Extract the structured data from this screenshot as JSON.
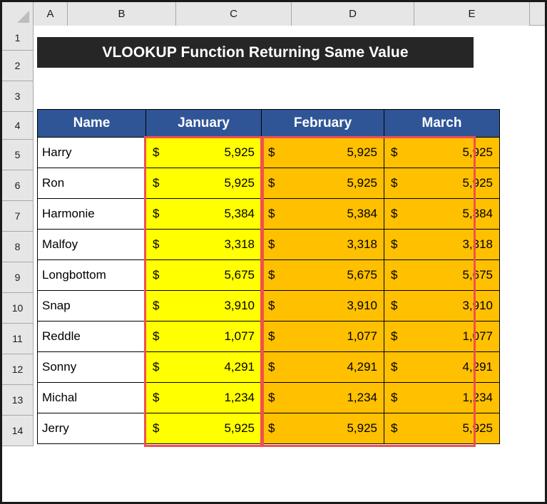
{
  "spreadsheet": {
    "column_headers": [
      "A",
      "B",
      "C",
      "D",
      "E"
    ],
    "row_headers": [
      "1",
      "2",
      "3",
      "4",
      "5",
      "6",
      "7",
      "8",
      "9",
      "10",
      "11",
      "12",
      "13",
      "14"
    ],
    "select_all_icon": "select-all-triangle-icon"
  },
  "title": {
    "text": "VLOOKUP Function Returning Same Value",
    "background": "#262626",
    "color": "#FFFFFF"
  },
  "table": {
    "headers": [
      "Name",
      "January",
      "February",
      "March"
    ],
    "header_background": "#2F5597",
    "header_color": "#FFFFFF",
    "currency_symbol": "$",
    "column_fills": {
      "name": "#FFFFFF",
      "january": "#FFFF00",
      "february": "#FFC000",
      "march": "#FFC000"
    },
    "range_outline_color": "#F24F4F",
    "rows": [
      {
        "name": "Harry",
        "january": "5,925",
        "february": "5,925",
        "march": "5,925"
      },
      {
        "name": "Ron",
        "january": "5,925",
        "february": "5,925",
        "march": "5,925"
      },
      {
        "name": "Harmonie",
        "january": "5,384",
        "february": "5,384",
        "march": "5,384"
      },
      {
        "name": "Malfoy",
        "january": "3,318",
        "february": "3,318",
        "march": "3,318"
      },
      {
        "name": "Longbottom",
        "january": "5,675",
        "february": "5,675",
        "march": "5,675"
      },
      {
        "name": "Snap",
        "january": "3,910",
        "february": "3,910",
        "march": "3,910"
      },
      {
        "name": "Reddle",
        "january": "1,077",
        "february": "1,077",
        "march": "1,077"
      },
      {
        "name": "Sonny",
        "january": "4,291",
        "february": "4,291",
        "march": "4,291"
      },
      {
        "name": "Michal",
        "january": "1,234",
        "february": "1,234",
        "march": "1,234"
      },
      {
        "name": "Jerry",
        "january": "5,925",
        "february": "5,925",
        "march": "5,925"
      }
    ]
  }
}
